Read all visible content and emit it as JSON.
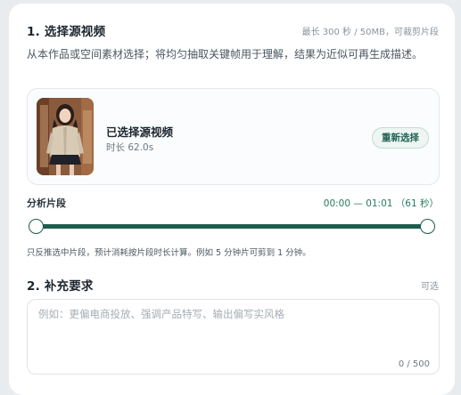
{
  "section1": {
    "title": "1. 选择源视频",
    "limit_note": "最长 300 秒 / 50MB，可裁剪片段",
    "description": "从本作品或空间素材选择；将均匀抽取关键帧用于理解，结果为近似可再生成描述。",
    "source": {
      "title": "已选择源视频",
      "duration": "时长 62.0s",
      "reselect_label": "重新选择"
    },
    "segment": {
      "label": "分析片段",
      "readout": "00:00 — 01:01 （61 秒）",
      "start_fraction": 0,
      "end_fraction": 1,
      "hint": "只反推选中片段，预计消耗按片段时长计算。例如 5 分钟片可剪到 1 分钟。"
    }
  },
  "section2": {
    "title": "2. 补充要求",
    "optional_note": "可选",
    "placeholder": "例如：更偏电商投放、强调产品特写、输出偏写实风格",
    "value": "",
    "counter": "0 / 500"
  },
  "colors": {
    "accent": "#1d5c4e",
    "accent_text": "#2a7a62",
    "card_bg": "#ffffff",
    "page_bg": "#e9ecef"
  }
}
